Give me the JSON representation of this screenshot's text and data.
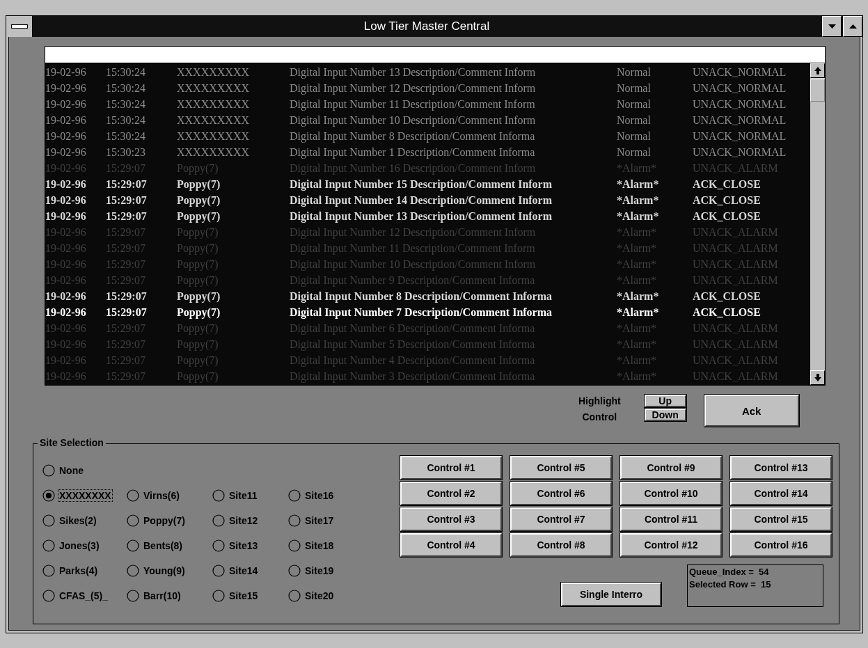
{
  "window": {
    "title": "Low Tier Master Central"
  },
  "log": {
    "rows": [
      {
        "date": "19-02-96",
        "time": "15:30:24",
        "source": "XXXXXXXXX",
        "description": "Digital Input Number 13 Description/Comment Inform",
        "status": "Normal",
        "state": "UNACK_NORMAL",
        "kind": "normal",
        "selected": false
      },
      {
        "date": "19-02-96",
        "time": "15:30:24",
        "source": "XXXXXXXXX",
        "description": "Digital Input Number 12 Description/Comment Inform",
        "status": "Normal",
        "state": "UNACK_NORMAL",
        "kind": "normal",
        "selected": false
      },
      {
        "date": "19-02-96",
        "time": "15:30:24",
        "source": "XXXXXXXXX",
        "description": "Digital Input Number 11 Description/Comment Inform",
        "status": "Normal",
        "state": "UNACK_NORMAL",
        "kind": "normal",
        "selected": false
      },
      {
        "date": "19-02-96",
        "time": "15:30:24",
        "source": "XXXXXXXXX",
        "description": "Digital Input Number 10 Description/Comment Inform",
        "status": "Normal",
        "state": "UNACK_NORMAL",
        "kind": "normal",
        "selected": false
      },
      {
        "date": "19-02-96",
        "time": "15:30:24",
        "source": "XXXXXXXXX",
        "description": "Digital Input Number 8 Description/Comment Informa",
        "status": "Normal",
        "state": "UNACK_NORMAL",
        "kind": "normal",
        "selected": false
      },
      {
        "date": "19-02-96",
        "time": "15:30:23",
        "source": "XXXXXXXXX",
        "description": "Digital Input Number 1 Description/Comment Informa",
        "status": "Normal",
        "state": "UNACK_NORMAL",
        "kind": "normal",
        "selected": false
      },
      {
        "date": "19-02-96",
        "time": "15:29:07",
        "source": "Poppy(7)",
        "description": "Digital Input Number 16 Description/Comment Inform",
        "status": "*Alarm*",
        "state": "UNACK_ALARM",
        "kind": "alarm",
        "selected": false
      },
      {
        "date": "19-02-96",
        "time": "15:29:07",
        "source": "Poppy(7)",
        "description": "Digital Input Number 15 Description/Comment Inform",
        "status": "*Alarm*",
        "state": "ACK_CLOSE",
        "kind": "ack",
        "selected": false
      },
      {
        "date": "19-02-96",
        "time": "15:29:07",
        "source": "Poppy(7)",
        "description": "Digital Input Number 14 Description/Comment Inform",
        "status": "*Alarm*",
        "state": "ACK_CLOSE",
        "kind": "ack",
        "selected": false
      },
      {
        "date": "19-02-96",
        "time": "15:29:07",
        "source": "Poppy(7)",
        "description": "Digital Input Number 13 Description/Comment Inform",
        "status": "*Alarm*",
        "state": "ACK_CLOSE",
        "kind": "ack",
        "selected": false
      },
      {
        "date": "19-02-96",
        "time": "15:29:07",
        "source": "Poppy(7)",
        "description": "Digital Input Number 12 Description/Comment Inform",
        "status": "*Alarm*",
        "state": "UNACK_ALARM",
        "kind": "alarm",
        "selected": false
      },
      {
        "date": "19-02-96",
        "time": "15:29:07",
        "source": "Poppy(7)",
        "description": "Digital Input Number 11 Description/Comment Inform",
        "status": "*Alarm*",
        "state": "UNACK_ALARM",
        "kind": "alarm",
        "selected": false
      },
      {
        "date": "19-02-96",
        "time": "15:29:07",
        "source": "Poppy(7)",
        "description": "Digital Input Number 10 Description/Comment Inform",
        "status": "*Alarm*",
        "state": "UNACK_ALARM",
        "kind": "alarm",
        "selected": false
      },
      {
        "date": "19-02-96",
        "time": "15:29:07",
        "source": "Poppy(7)",
        "description": "Digital Input Number 9 Description/Comment Informa",
        "status": "*Alarm*",
        "state": "UNACK_ALARM",
        "kind": "alarm",
        "selected": false
      },
      {
        "date": "19-02-96",
        "time": "15:29:07",
        "source": "Poppy(7)",
        "description": "Digital Input Number 8 Description/Comment Informa",
        "status": "*Alarm*",
        "state": "ACK_CLOSE",
        "kind": "ack",
        "selected": false
      },
      {
        "date": "19-02-96",
        "time": "15:29:07",
        "source": "Poppy(7)",
        "description": "Digital Input Number 7 Description/Comment Informa",
        "status": "*Alarm*",
        "state": "ACK_CLOSE",
        "kind": "ack",
        "selected": true
      },
      {
        "date": "19-02-96",
        "time": "15:29:07",
        "source": "Poppy(7)",
        "description": "Digital Input Number 6 Description/Comment Informa",
        "status": "*Alarm*",
        "state": "UNACK_ALARM",
        "kind": "alarm",
        "selected": false
      },
      {
        "date": "19-02-96",
        "time": "15:29:07",
        "source": "Poppy(7)",
        "description": "Digital Input Number 5 Description/Comment Informa",
        "status": "*Alarm*",
        "state": "UNACK_ALARM",
        "kind": "alarm",
        "selected": false
      },
      {
        "date": "19-02-96",
        "time": "15:29:07",
        "source": "Poppy(7)",
        "description": "Digital Input Number 4 Description/Comment Informa",
        "status": "*Alarm*",
        "state": "UNACK_ALARM",
        "kind": "alarm",
        "selected": false
      },
      {
        "date": "19-02-96",
        "time": "15:29:07",
        "source": "Poppy(7)",
        "description": "Digital Input Number 3 Description/Comment Informa",
        "status": "*Alarm*",
        "state": "UNACK_ALARM",
        "kind": "alarm",
        "selected": false
      }
    ]
  },
  "highlight_control": {
    "label": "Highlight Control",
    "up_button": "Up",
    "down_button": "Down"
  },
  "ack_button": "Ack",
  "site_selection": {
    "title": "Site Selection",
    "rows": [
      [
        {
          "label": "None",
          "selected": false,
          "focused": false
        }
      ],
      [
        {
          "label": "XXXXXXXX",
          "selected": true,
          "focused": true
        },
        {
          "label": "Virns(6)",
          "selected": false,
          "focused": false
        },
        {
          "label": "Site11",
          "selected": false,
          "focused": false
        },
        {
          "label": "Site16",
          "selected": false,
          "focused": false
        }
      ],
      [
        {
          "label": "Sikes(2)",
          "selected": false,
          "focused": false
        },
        {
          "label": "Poppy(7)",
          "selected": false,
          "focused": false
        },
        {
          "label": "Site12",
          "selected": false,
          "focused": false
        },
        {
          "label": "Site17",
          "selected": false,
          "focused": false
        }
      ],
      [
        {
          "label": "Jones(3)",
          "selected": false,
          "focused": false
        },
        {
          "label": "Bents(8)",
          "selected": false,
          "focused": false
        },
        {
          "label": "Site13",
          "selected": false,
          "focused": false
        },
        {
          "label": "Site18",
          "selected": false,
          "focused": false
        }
      ],
      [
        {
          "label": "Parks(4)",
          "selected": false,
          "focused": false
        },
        {
          "label": "Young(9)",
          "selected": false,
          "focused": false
        },
        {
          "label": "Site14",
          "selected": false,
          "focused": false
        },
        {
          "label": "Site19",
          "selected": false,
          "focused": false
        }
      ],
      [
        {
          "label": "CFAS_(5)_",
          "selected": false,
          "focused": false
        },
        {
          "label": "Barr(10)",
          "selected": false,
          "focused": false
        },
        {
          "label": "Site15",
          "selected": false,
          "focused": false
        },
        {
          "label": "Site20",
          "selected": false,
          "focused": false
        }
      ]
    ]
  },
  "control_buttons": [
    "Control #1",
    "Control #5",
    "Control #9",
    "Control #13",
    "Control #2",
    "Control #6",
    "Control #10",
    "Control #14",
    "Control #3",
    "Control #7",
    "Control #11",
    "Control #15",
    "Control #4",
    "Control #8",
    "Control #12",
    "Control #16"
  ],
  "single_interro_button": "Single Interro",
  "status_box": {
    "lines": [
      "Queue_Index =  54",
      "Selected Row =  15"
    ]
  }
}
